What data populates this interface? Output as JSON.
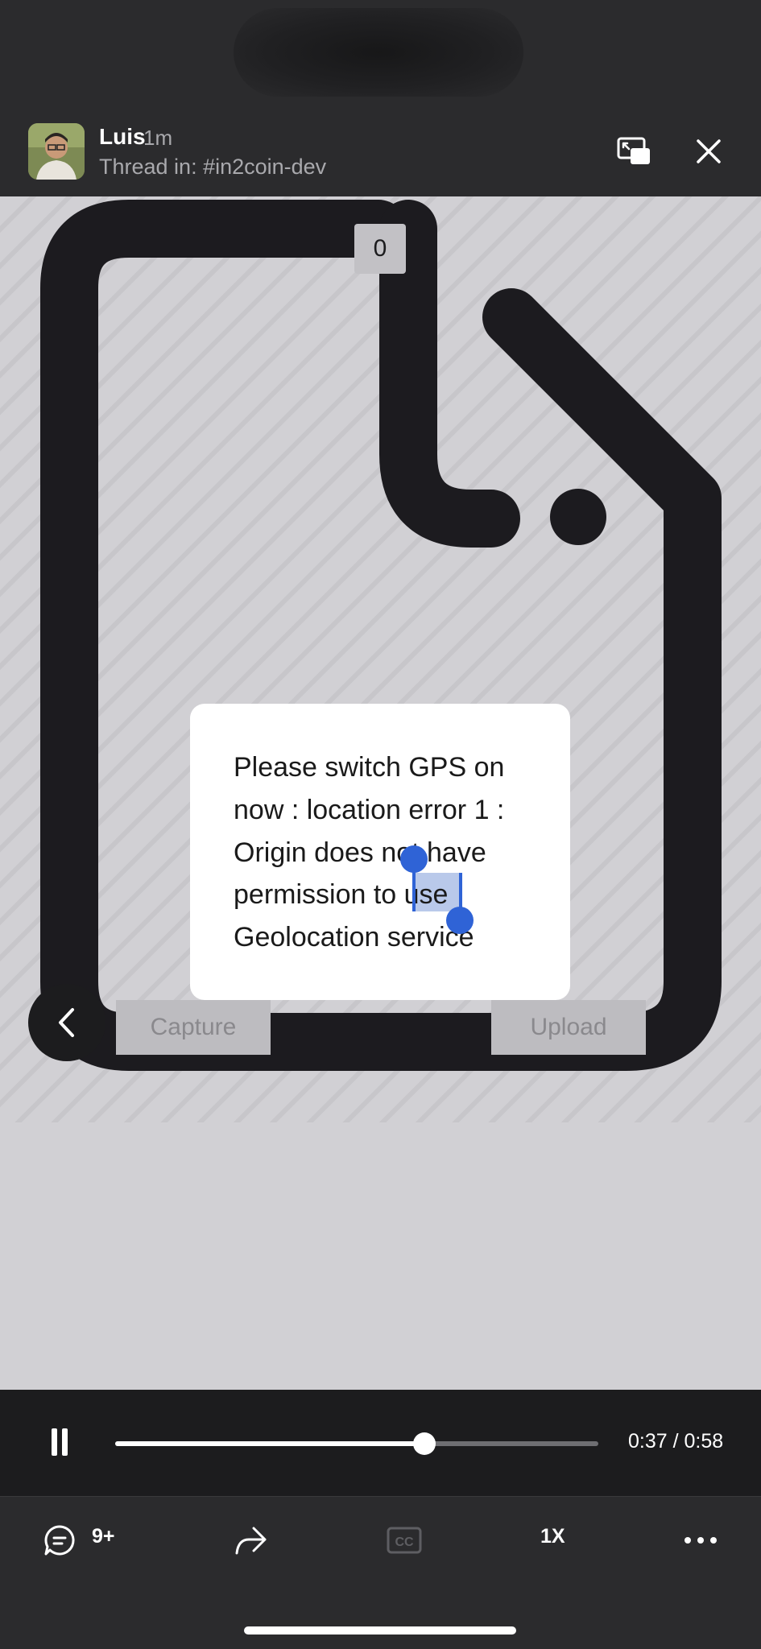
{
  "header": {
    "user_name": "Luis",
    "time_ago": "1m",
    "thread_label": "Thread in: #in2coin-dev"
  },
  "video": {
    "badge_count": "0",
    "dialog_lines": [
      "Please switch GPS on",
      "now : location error 1 :",
      "Origin does not have",
      "permission to use",
      "Geolocation service"
    ],
    "capture_label": "Capture",
    "upload_label": "Upload"
  },
  "player": {
    "progress": 0.64,
    "time_text": "0:37 / 0:58"
  },
  "toolbar": {
    "replies_count": "9+",
    "cc_label": "CC",
    "speed_label": "1X"
  },
  "icons": [
    "pip-icon",
    "close-icon",
    "chevron-left-icon",
    "pause-icon",
    "reply-icon",
    "share-icon",
    "cc-icon",
    "more-icon"
  ],
  "colors": {
    "background": "#1c1c1e",
    "header": "#2b2b2d",
    "selection": "#2f63d6"
  }
}
